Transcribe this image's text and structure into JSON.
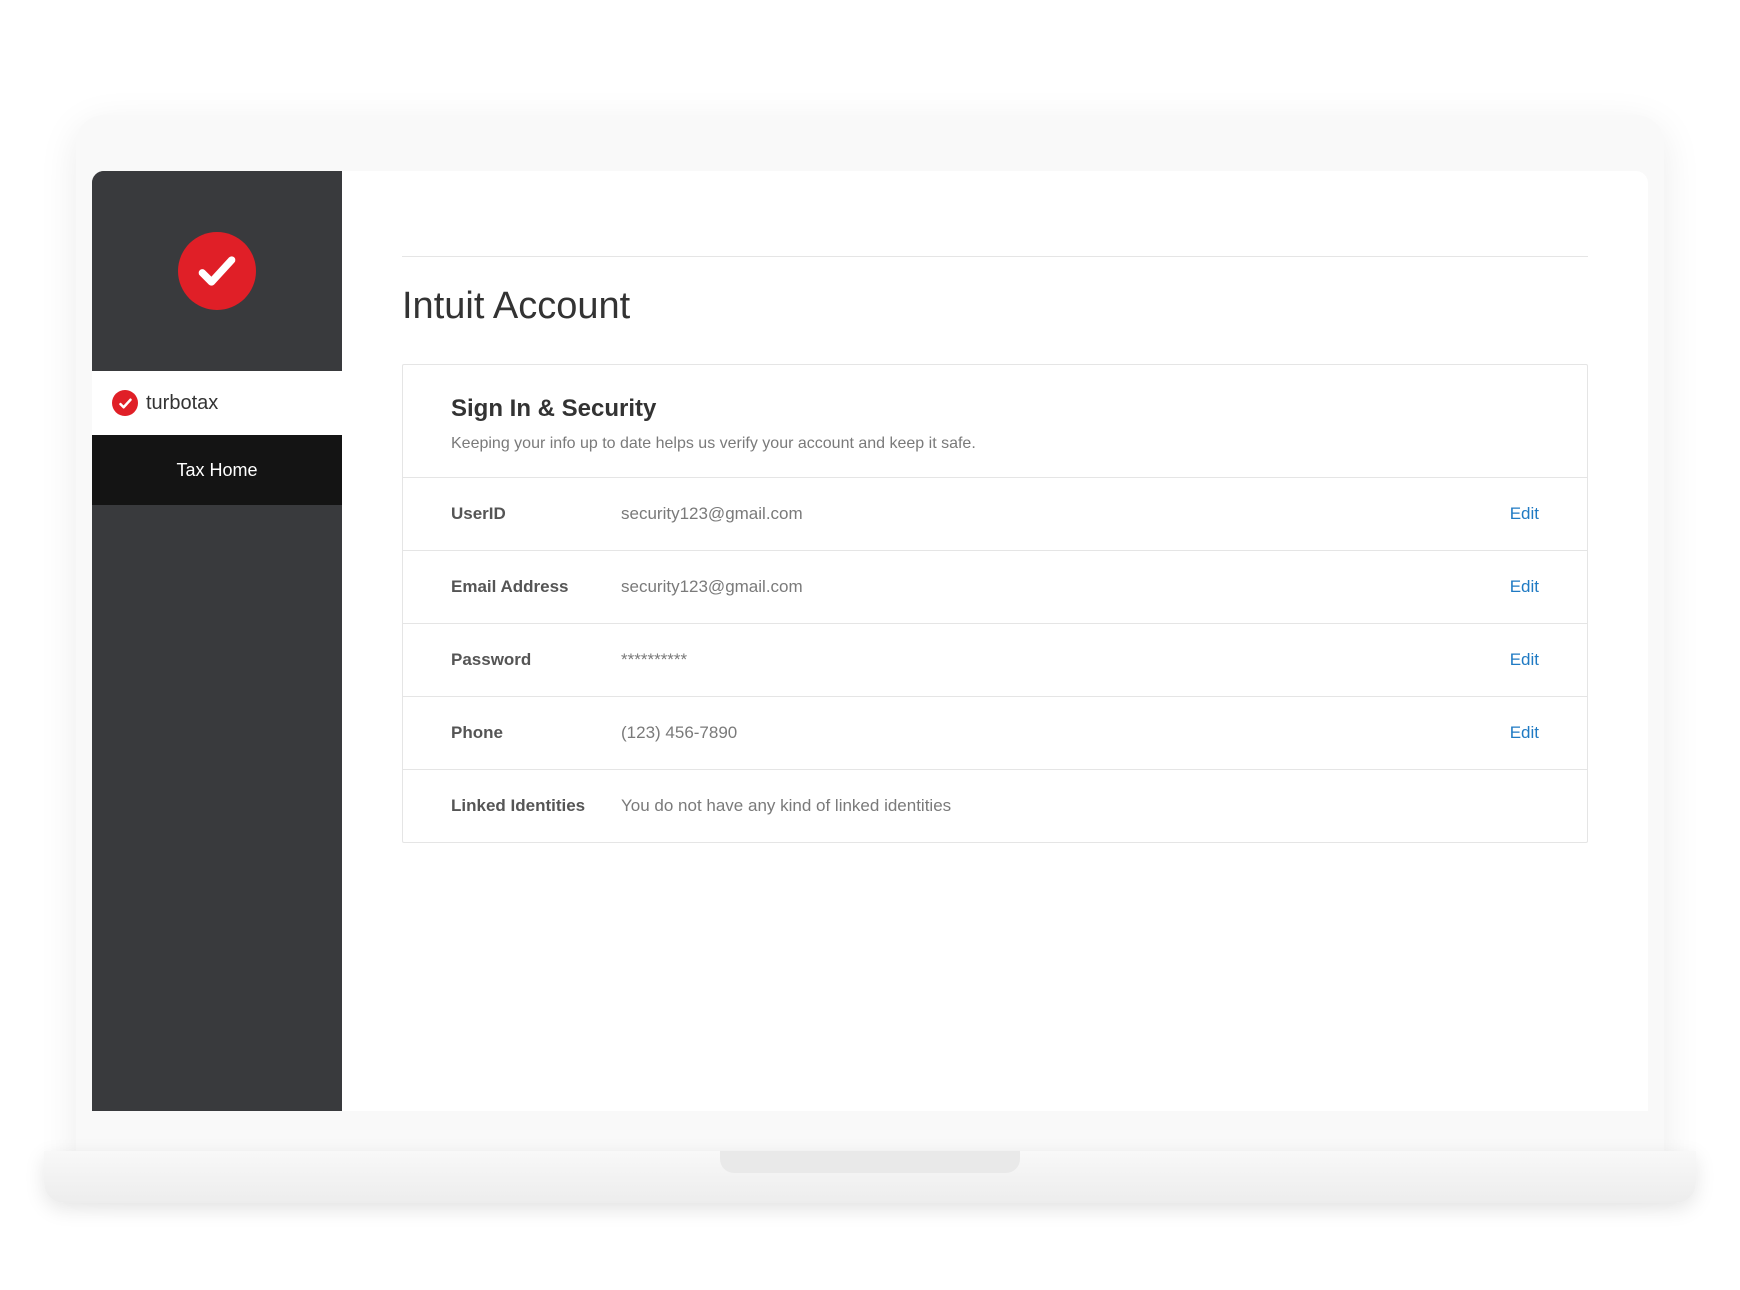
{
  "brand": {
    "name": "turbotax"
  },
  "sidebar": {
    "nav": [
      {
        "label": "Tax Home"
      }
    ]
  },
  "page": {
    "title": "Intuit Account"
  },
  "card": {
    "title": "Sign In & Security",
    "subtitle": "Keeping your info up to date helps us verify your account and keep it safe.",
    "rows": [
      {
        "label": "UserID",
        "value": "security123@gmail.com",
        "action": "Edit"
      },
      {
        "label": "Email Address",
        "value": "security123@gmail.com",
        "action": "Edit"
      },
      {
        "label": "Password",
        "value": "**********",
        "action": "Edit"
      },
      {
        "label": "Phone",
        "value": "(123) 456-7890",
        "action": "Edit"
      },
      {
        "label": "Linked Identities",
        "value": "You do not have any kind of linked identities",
        "action": ""
      }
    ]
  },
  "colors": {
    "brandRed": "#e01f27",
    "sidebarDark": "#393a3d",
    "navDark": "#141414",
    "link": "#1f7ac3"
  }
}
